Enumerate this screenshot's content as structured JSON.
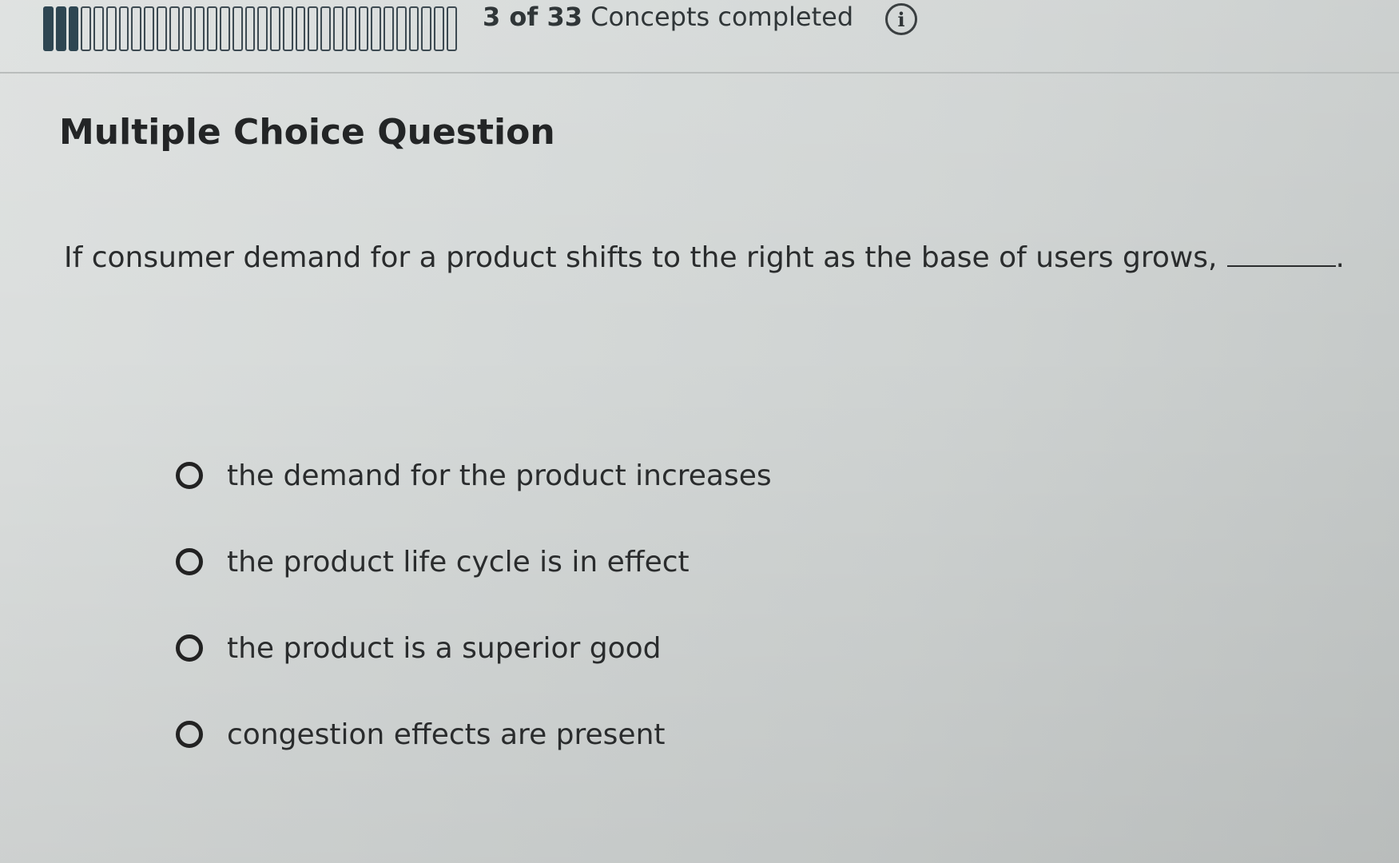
{
  "header": {
    "progress_completed": 3,
    "progress_total": 33,
    "progress_count": "3 of 33",
    "progress_suffix": "Concepts completed",
    "info_glyph": "i",
    "colors": {
      "segment_done": "#2e4652",
      "segment_outline": "#3d4a52"
    }
  },
  "question": {
    "type_label": "Multiple Choice Question",
    "text": "If consumer demand for a product shifts to the right as the base of users grows,",
    "end_punctuation": ".",
    "options": [
      {
        "label": "the demand for the product increases"
      },
      {
        "label": "the product life cycle is in effect"
      },
      {
        "label": "the product is a superior good"
      },
      {
        "label": "congestion effects are present"
      }
    ]
  },
  "icons": {
    "info": "info-circle-icon",
    "radio": "radio-unselected-icon"
  }
}
